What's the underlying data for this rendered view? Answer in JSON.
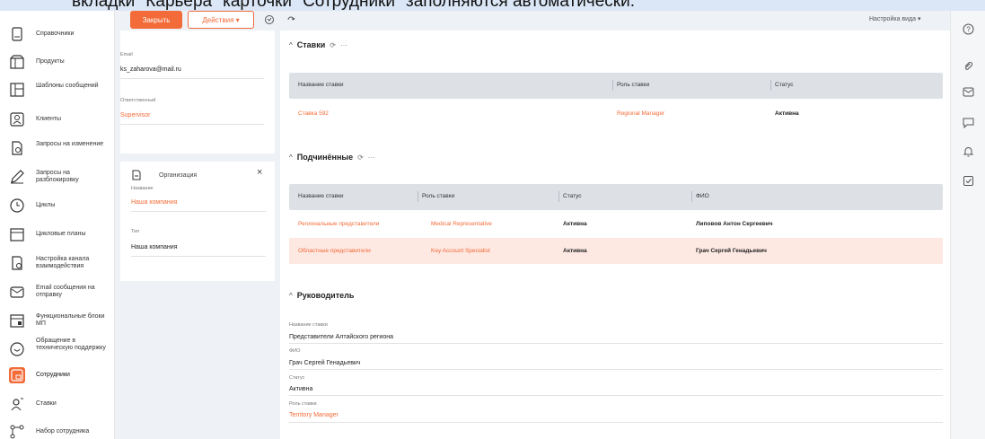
{
  "banner": {
    "text": "вкладки \"Карьера\" карточки \"Сотрудники\" заполняются автоматически."
  },
  "sidebar": {
    "items": [
      {
        "label": "Справочники",
        "icon": "book-icon"
      },
      {
        "label": "Продукты",
        "icon": "product-icon"
      },
      {
        "label": "Шаблоны сообщений",
        "icon": "template-icon"
      },
      {
        "label": "Клиенты",
        "icon": "client-icon"
      },
      {
        "label": "Запросы на изменение",
        "icon": "request-change-icon"
      },
      {
        "label": "Запросы на разблокировку",
        "icon": "pencil-icon"
      },
      {
        "label": "Циклы",
        "icon": "clock-icon"
      },
      {
        "label": "Цикловые планы",
        "icon": "calendar-icon"
      },
      {
        "label": "Настройка канала взаимодействия",
        "icon": "channel-settings-icon"
      },
      {
        "label": "Email сообщения на отправку",
        "icon": "mail-icon"
      },
      {
        "label": "Функциональные блоки МП",
        "icon": "blocks-icon"
      },
      {
        "label": "Обращение в техническую поддержку",
        "icon": "support-icon"
      },
      {
        "label": "Сотрудники",
        "icon": "employee-icon"
      },
      {
        "label": "Ставки",
        "icon": "rate-icon"
      },
      {
        "label": "Набор сотрудника",
        "icon": "hierarchy-icon"
      }
    ]
  },
  "toolbar": {
    "close_label": "Закрыть",
    "actions_label": "Действия ▾",
    "view_setup": "Настройка вида ▾"
  },
  "info": {
    "email_label": "Email",
    "email_value": "ks_zaharova@mail.ru",
    "responsible_label": "Ответственный",
    "responsible_value": "Supervisor"
  },
  "org_card": {
    "title": "Организация",
    "name_label": "Название",
    "name_value": "Наша компания",
    "type_label": "Тип",
    "type_value": "Наша компания"
  },
  "rates": {
    "title": "Ставки",
    "columns": [
      "Название ставки",
      "Роль ставки",
      "Статус"
    ],
    "rows": [
      {
        "name": "Ставка 592",
        "role": "Regional Manager",
        "status": "Активна"
      }
    ]
  },
  "subordinates": {
    "title": "Подчинённые",
    "columns": [
      "Название ставки",
      "Роль ставки",
      "Статус",
      "ФИО"
    ],
    "rows": [
      {
        "name": "Региональные представители",
        "role": "Medical Representative",
        "status": "Активна",
        "fio": "Липовов Антон Сергеевич"
      },
      {
        "name": "Областные представители",
        "role": "Key Account Specialist",
        "status": "Активна",
        "fio": "Грач Сергей Генадьевич"
      }
    ]
  },
  "manager": {
    "title": "Руководитель",
    "rate_name_label": "Название ставки",
    "rate_name_value": "Представители Алтайского региона",
    "fio_label": "ФИО",
    "fio_value": "Грач Сергей Генадьевич",
    "status_label": "Статус",
    "status_value": "Активна",
    "role_label": "Роль ставки",
    "role_value": "Territory Manager"
  },
  "colors": {
    "accent": "#f26b38",
    "header_bg": "#dde0e5",
    "highlight_row": "#fde8e2"
  }
}
